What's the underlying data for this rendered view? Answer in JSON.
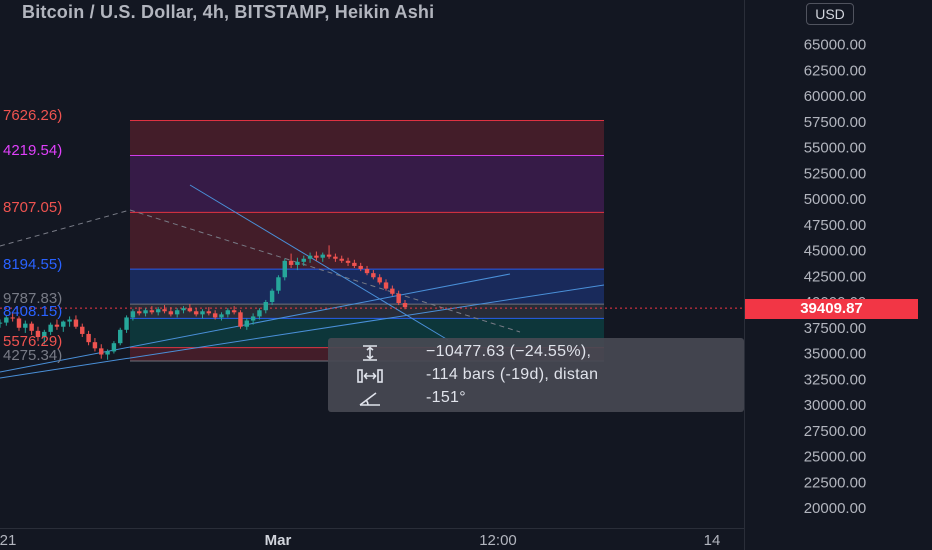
{
  "chart_title": "Bitcoin / U.S. Dollar, 4h, BITSTAMP, Heikin Ashi",
  "currency": "USD",
  "current_price": "39409.87",
  "colors": {
    "background": "#131722",
    "up": "#26a69a",
    "down": "#ef5350",
    "price_tag": "#f23645",
    "trendline": "#4a90d9"
  },
  "left_price_labels": [
    {
      "text": "7626.26)",
      "color": "#ef5350"
    },
    {
      "text": "4219.54)",
      "color": "#e040fb"
    },
    {
      "text": "8707.05)",
      "color": "#ef5350"
    },
    {
      "text": "8194.55)",
      "color": "#2962ff"
    },
    {
      "text": "9787.83)",
      "color": "#787b86"
    },
    {
      "text": "8408.15)",
      "color": "#2962ff"
    },
    {
      "text": "5576.29)",
      "color": "#ef5350"
    },
    {
      "text": "4275.34)",
      "color": "#787b86"
    }
  ],
  "measure_tool": {
    "price_range": "−10477.63 (−24.55%), ",
    "bar_range": "-114 bars (-19d), distan",
    "angle": "-151°",
    "icons": [
      "vertical-measure-icon",
      "horizontal-measure-icon",
      "angle-icon"
    ]
  },
  "chart_data": {
    "type": "candlestick",
    "title": "Bitcoin / U.S. Dollar, 4h, BITSTAMP, Heikin Ashi",
    "y_axis": {
      "ticks": [
        "20000.00",
        "22500.00",
        "25000.00",
        "27500.00",
        "30000.00",
        "32500.00",
        "35000.00",
        "37500.00",
        "40000.00",
        "42500.00",
        "45000.00",
        "47500.00",
        "50000.00",
        "52500.00",
        "55000.00",
        "57500.00",
        "60000.00",
        "62500.00",
        "65000.00"
      ],
      "range": [
        19000,
        68500
      ]
    },
    "x_axis": {
      "ticks": [
        "21",
        "Mar",
        "12:00",
        "14"
      ]
    },
    "last_price": 39409.87,
    "fib_levels": [
      57626.26,
      54219.54,
      48707.05,
      43194.55,
      39787.83,
      38408.15,
      35576.29,
      34275.34
    ],
    "candles": [
      [
        37900,
        38300,
        37500,
        38000
      ],
      [
        38000,
        38700,
        37700,
        38500
      ],
      [
        38500,
        39000,
        38100,
        38400
      ],
      [
        38400,
        38600,
        37200,
        37500
      ],
      [
        37500,
        38200,
        37000,
        37900
      ],
      [
        37900,
        38100,
        36800,
        37200
      ],
      [
        37200,
        37600,
        36200,
        36600
      ],
      [
        36600,
        37300,
        35900,
        37100
      ],
      [
        37100,
        38000,
        36800,
        37800
      ],
      [
        37800,
        38300,
        37300,
        37600
      ],
      [
        37600,
        38200,
        37100,
        38100
      ],
      [
        38100,
        38600,
        37600,
        38300
      ],
      [
        38300,
        38700,
        37400,
        37600
      ],
      [
        37600,
        37900,
        36600,
        36900
      ],
      [
        36900,
        37200,
        35800,
        36100
      ],
      [
        36100,
        36500,
        35200,
        35500
      ],
      [
        35500,
        35900,
        34500,
        34900
      ],
      [
        34900,
        35400,
        34400,
        35200
      ],
      [
        35200,
        36200,
        35000,
        36000
      ],
      [
        36000,
        37500,
        35800,
        37300
      ],
      [
        37300,
        38700,
        37000,
        38500
      ],
      [
        38500,
        39300,
        38200,
        39100
      ],
      [
        39100,
        39500,
        38700,
        38900
      ],
      [
        38900,
        39400,
        38600,
        39200
      ],
      [
        39200,
        39600,
        38800,
        39000
      ],
      [
        39000,
        39500,
        38700,
        39300
      ],
      [
        39300,
        39700,
        38900,
        39100
      ],
      [
        39100,
        39500,
        38600,
        38800
      ],
      [
        38800,
        39400,
        38500,
        39200
      ],
      [
        39200,
        39600,
        38900,
        39400
      ],
      [
        39400,
        39800,
        39000,
        39100
      ],
      [
        39100,
        39400,
        38600,
        38800
      ],
      [
        38800,
        39300,
        38400,
        39100
      ],
      [
        39100,
        39500,
        38700,
        38900
      ],
      [
        38900,
        39200,
        38300,
        38500
      ],
      [
        38500,
        39000,
        38200,
        38800
      ],
      [
        38800,
        39400,
        38500,
        39200
      ],
      [
        39200,
        39600,
        38800,
        39000
      ],
      [
        39000,
        39200,
        37400,
        37600
      ],
      [
        37600,
        38400,
        37300,
        38200
      ],
      [
        38200,
        38900,
        37800,
        38600
      ],
      [
        38600,
        39400,
        38300,
        39200
      ],
      [
        39200,
        40200,
        38900,
        40000
      ],
      [
        40000,
        41300,
        39700,
        41100
      ],
      [
        41100,
        42600,
        40800,
        42400
      ],
      [
        42400,
        44200,
        42100,
        44000
      ],
      [
        44000,
        44700,
        43300,
        43600
      ],
      [
        43600,
        44300,
        43100,
        43900
      ],
      [
        43900,
        44500,
        43500,
        44200
      ],
      [
        44200,
        44800,
        43800,
        44500
      ],
      [
        44500,
        44900,
        44000,
        44300
      ],
      [
        44300,
        44800,
        43900,
        44600
      ],
      [
        44600,
        45500,
        44200,
        44400
      ],
      [
        44400,
        44700,
        43900,
        44200
      ],
      [
        44200,
        44500,
        43800,
        44000
      ],
      [
        44000,
        44300,
        43500,
        43800
      ],
      [
        43800,
        44100,
        43300,
        43500
      ],
      [
        43500,
        43800,
        43000,
        43200
      ],
      [
        43200,
        43500,
        42600,
        42800
      ],
      [
        42800,
        43100,
        42200,
        42400
      ],
      [
        42400,
        42700,
        41700,
        41900
      ],
      [
        41900,
        42200,
        41100,
        41300
      ],
      [
        41300,
        41600,
        40600,
        40800
      ],
      [
        40800,
        41100,
        39700,
        39900
      ],
      [
        39900,
        40200,
        39300,
        39500
      ]
    ]
  }
}
